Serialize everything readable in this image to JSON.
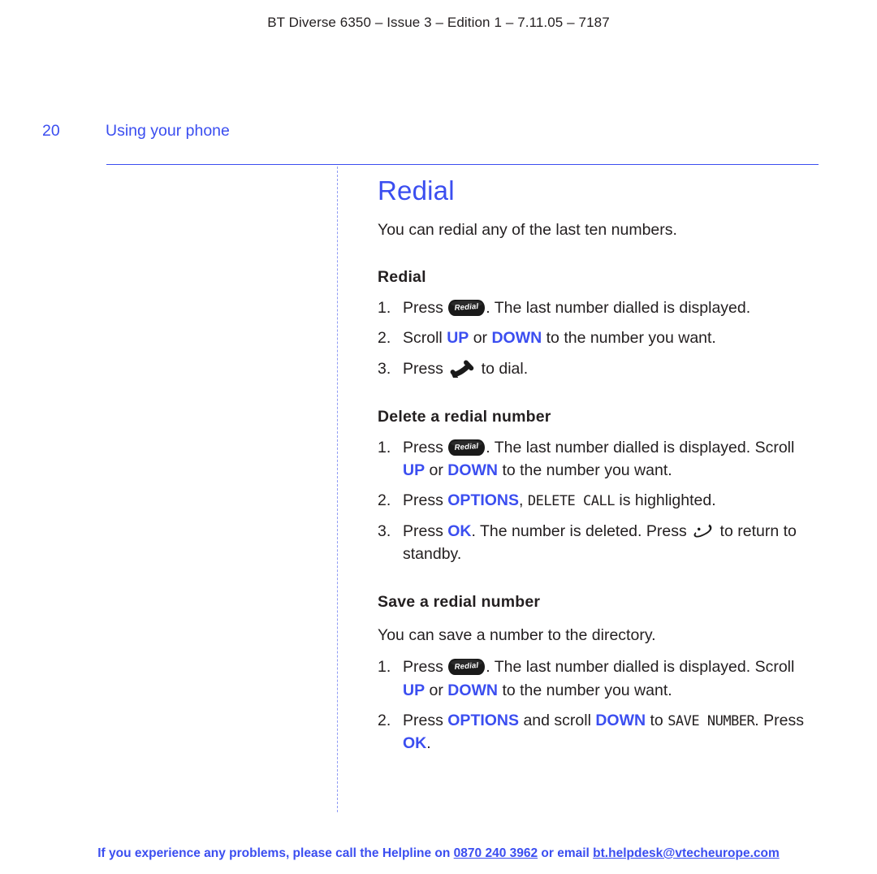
{
  "header": {
    "text": "BT Diverse 6350 – Issue 3 – Edition 1 – 7.11.05 – 7187"
  },
  "running_head": {
    "page_number": "20",
    "section": "Using your phone"
  },
  "content": {
    "title": "Redial",
    "intro": "You can redial any of the last ten numbers.",
    "sections": [
      {
        "heading": "Redial",
        "steps": [
          {
            "num": "1.",
            "parts": [
              {
                "type": "text",
                "text": "Press "
              },
              {
                "type": "icon",
                "icon": "redial-key-icon",
                "label": "Redial"
              },
              {
                "type": "text",
                "text": ". The last number dialled is displayed."
              }
            ]
          },
          {
            "num": "2.",
            "parts": [
              {
                "type": "text",
                "text": "Scroll "
              },
              {
                "type": "blue",
                "text": "UP"
              },
              {
                "type": "text",
                "text": " or "
              },
              {
                "type": "blue",
                "text": "DOWN"
              },
              {
                "type": "text",
                "text": " to the number you want."
              }
            ]
          },
          {
            "num": "3.",
            "parts": [
              {
                "type": "text",
                "text": "Press "
              },
              {
                "type": "icon",
                "icon": "talk-handset-icon"
              },
              {
                "type": "text",
                "text": " to dial."
              }
            ]
          }
        ]
      },
      {
        "heading": "Delete a redial number",
        "steps": [
          {
            "num": "1.",
            "parts": [
              {
                "type": "text",
                "text": "Press "
              },
              {
                "type": "icon",
                "icon": "redial-key-icon",
                "label": "Redial"
              },
              {
                "type": "text",
                "text": ". The last number dialled is displayed. Scroll "
              },
              {
                "type": "blue",
                "text": "UP"
              },
              {
                "type": "text",
                "text": " or "
              },
              {
                "type": "blue",
                "text": "DOWN"
              },
              {
                "type": "text",
                "text": " to the number you want."
              }
            ]
          },
          {
            "num": "2.",
            "parts": [
              {
                "type": "text",
                "text": "Press "
              },
              {
                "type": "blue",
                "text": "OPTIONS"
              },
              {
                "type": "text",
                "text": ", "
              },
              {
                "type": "lcd",
                "text": "DELETE CALL"
              },
              {
                "type": "text",
                "text": " is highlighted."
              }
            ]
          },
          {
            "num": "3.",
            "parts": [
              {
                "type": "text",
                "text": "Press "
              },
              {
                "type": "blue",
                "text": "OK"
              },
              {
                "type": "text",
                "text": ". The number is deleted. Press "
              },
              {
                "type": "icon",
                "icon": "end-call-icon"
              },
              {
                "type": "text",
                "text": " to return to standby."
              }
            ]
          }
        ]
      },
      {
        "heading": "Save a redial number",
        "lead": "You can save a number to the directory.",
        "steps": [
          {
            "num": "1.",
            "parts": [
              {
                "type": "text",
                "text": "Press "
              },
              {
                "type": "icon",
                "icon": "redial-key-icon",
                "label": "Redial"
              },
              {
                "type": "text",
                "text": ". The last number dialled is displayed. Scroll "
              },
              {
                "type": "blue",
                "text": "UP"
              },
              {
                "type": "text",
                "text": " or "
              },
              {
                "type": "blue",
                "text": "DOWN"
              },
              {
                "type": "text",
                "text": " to the number you want."
              }
            ]
          },
          {
            "num": "2.",
            "parts": [
              {
                "type": "text",
                "text": "Press "
              },
              {
                "type": "blue",
                "text": "OPTIONS"
              },
              {
                "type": "text",
                "text": " and scroll "
              },
              {
                "type": "blue",
                "text": "DOWN"
              },
              {
                "type": "text",
                "text": " to "
              },
              {
                "type": "lcd",
                "text": "SAVE NUMBER"
              },
              {
                "type": "text",
                "text": ". Press "
              },
              {
                "type": "blue",
                "text": "OK"
              },
              {
                "type": "text",
                "text": "."
              }
            ]
          }
        ]
      }
    ]
  },
  "footer": {
    "lead": "If you experience any problems, please call the Helpline on ",
    "phone": "0870 240 3962",
    "middle": " or email ",
    "email": "bt.helpdesk@vtecheurope.com"
  },
  "colors": {
    "accent_blue": "#3b4ef0",
    "body_text": "#231f20"
  }
}
